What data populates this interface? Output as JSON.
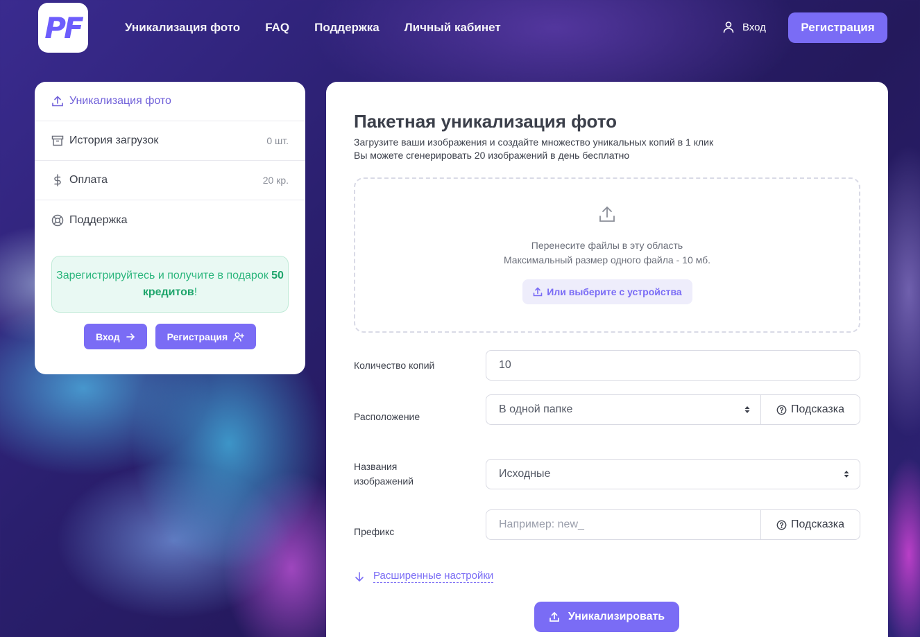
{
  "brand": {
    "logo_text": "PF",
    "accent_color": "#7a6cf5"
  },
  "header": {
    "nav": [
      "Уникализация фото",
      "FAQ",
      "Поддержка",
      "Личный кабинет"
    ],
    "login_label": "Вход",
    "register_label": "Регистрация"
  },
  "sidebar": {
    "items": [
      {
        "label": "Уникализация фото",
        "icon": "upload-icon",
        "count": ""
      },
      {
        "label": "История загрузок",
        "icon": "archive-icon",
        "count": "0 шт."
      },
      {
        "label": "Оплата",
        "icon": "dollar-icon",
        "count": "20 кр."
      },
      {
        "label": "Поддержка",
        "icon": "lifebuoy-icon",
        "count": ""
      }
    ],
    "promo": {
      "text_before": "Зарегистрируйтесь и получите в подарок ",
      "highlight": "50 кредитов",
      "text_after": "!"
    },
    "login_button": "Вход",
    "register_button": "Регистрация"
  },
  "main": {
    "title": "Пакетная уникализация фото",
    "subtitle_line1": "Загрузите ваши изображения и создайте множество уникальных копий в 1 клик",
    "subtitle_line2": "Вы можете сгенерировать 20 изображений в день бесплатно",
    "dropzone": {
      "line1": "Перенесите файлы в эту область",
      "line2": "Максимальный размер одного файла - 10 мб.",
      "button": "Или выберите с устройства"
    },
    "fields": {
      "copies_label": "Количество копий",
      "copies_value": "10",
      "location_label": "Расположение",
      "location_value": "В одной папке",
      "names_label_1": "Названия",
      "names_label_2": "изображений",
      "names_value": "Исходные",
      "prefix_label": "Префикс",
      "prefix_placeholder": "Например: new_",
      "hint_label": "Подсказка"
    },
    "advanced_label": "Расширенные настройки",
    "submit_label": "Уникализировать"
  }
}
